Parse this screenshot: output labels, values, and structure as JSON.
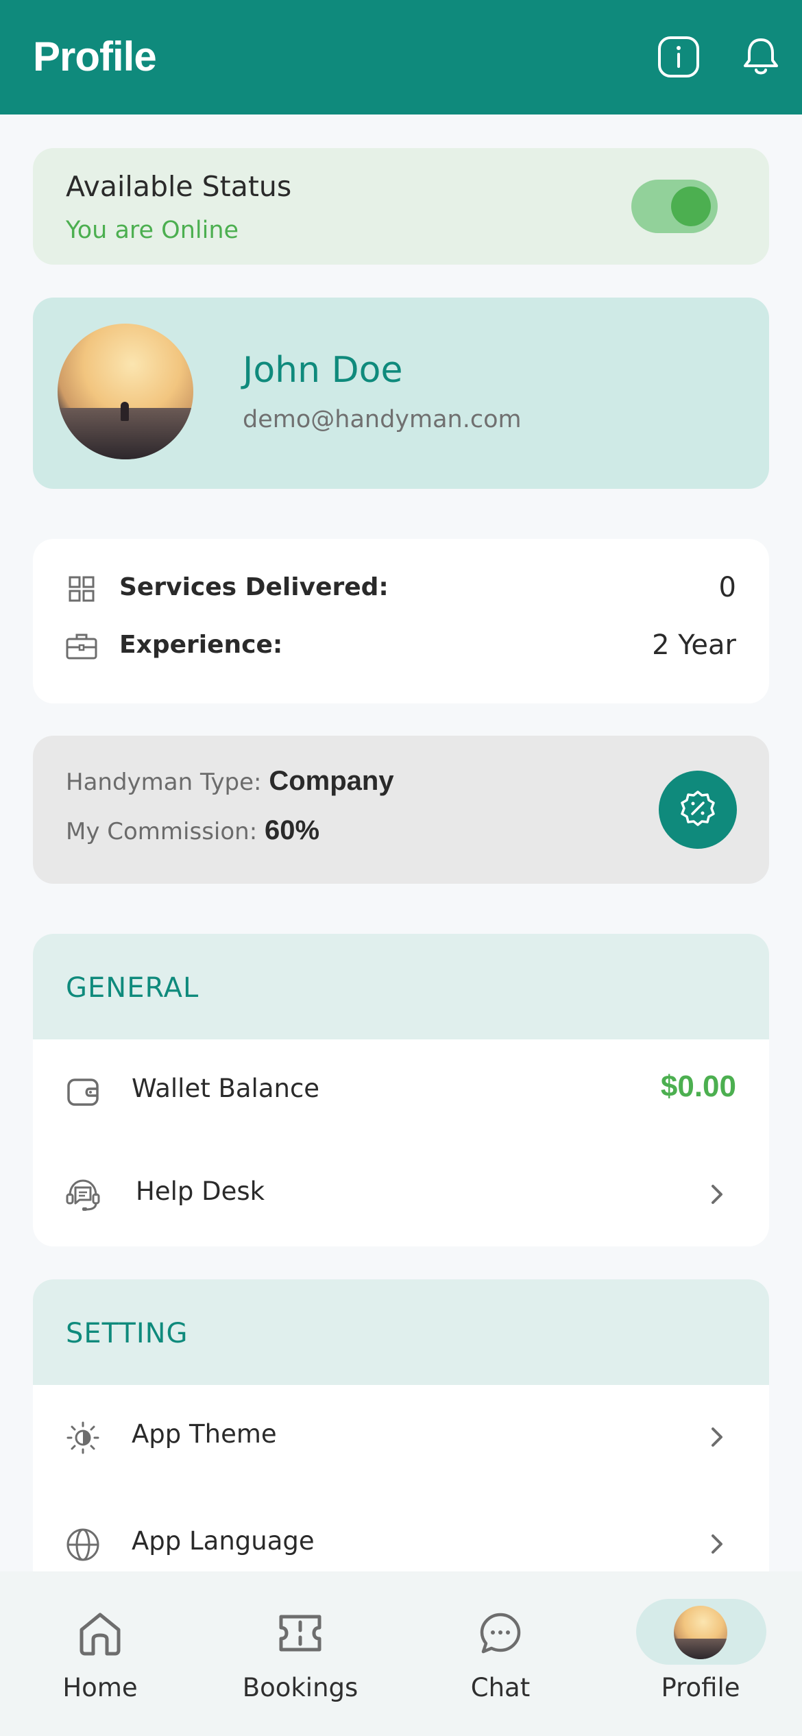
{
  "header": {
    "title": "Profile",
    "icons": [
      "info-icon",
      "bell-icon"
    ]
  },
  "status": {
    "label": "Available Status",
    "sub": "You are Online",
    "toggle_on": true
  },
  "profile": {
    "name": "John Doe",
    "email": "demo@handyman.com"
  },
  "stats": {
    "services_label": "Services Delivered:",
    "services_value": "0",
    "experience_label": "Experience:",
    "experience_value": "2 Year"
  },
  "handyman": {
    "type_label": "Handyman Type: ",
    "type_value": "Company",
    "commission_label": "My Commission: ",
    "commission_value": "60%"
  },
  "general": {
    "title": "GENERAL",
    "wallet_label": "Wallet Balance",
    "wallet_value": "$0.00",
    "helpdesk_label": "Help Desk"
  },
  "setting": {
    "title": "SETTING",
    "theme_label": "App Theme",
    "language_label": "App Language"
  },
  "nav": {
    "home": "Home",
    "bookings": "Bookings",
    "chat": "Chat",
    "profile": "Profile"
  },
  "colors": {
    "primary": "#0f8a7c",
    "online_green": "#4caf50",
    "status_bg": "#e6f1e7",
    "profile_bg": "#cfeae6",
    "section_head_bg": "#e0efed"
  }
}
